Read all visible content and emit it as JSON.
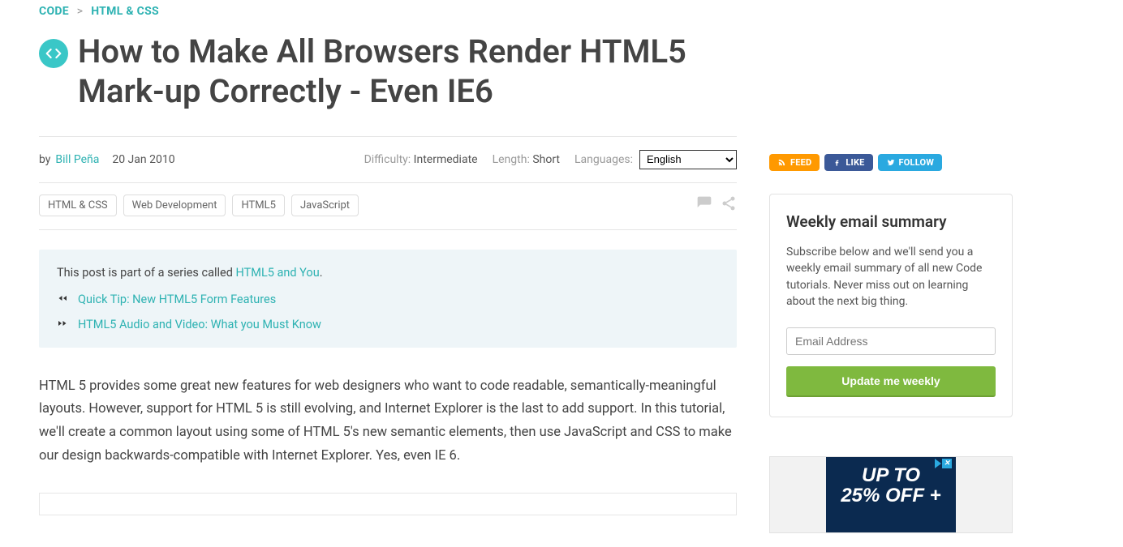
{
  "breadcrumb": {
    "level1": "CODE",
    "level2": "HTML & CSS"
  },
  "title": "How to Make All Browsers Render HTML5 Mark-up Correctly - Even IE6",
  "meta": {
    "by_label": "by",
    "author": "Bill Peña",
    "date": "20 Jan 2010",
    "difficulty_label": "Difficulty:",
    "difficulty_value": "Intermediate",
    "length_label": "Length:",
    "length_value": "Short",
    "languages_label": "Languages:",
    "language_selected": "English"
  },
  "tags": [
    "HTML & CSS",
    "Web Development",
    "HTML5",
    "JavaScript"
  ],
  "series": {
    "intro_prefix": "This post is part of a series called ",
    "name": "HTML5 and You",
    "suffix": ".",
    "prev": "Quick Tip: New HTML5 Form Features",
    "next": "HTML5 Audio and Video: What you Must Know"
  },
  "body_p1": "HTML 5 provides some great new features for web designers who want to code readable, semantically-meaningful layouts. However, support for HTML 5 is still evolving, and Internet Explorer is the last to add support. In this tutorial, we'll create a common layout using some of HTML 5's new semantic elements, then use JavaScript and CSS to make our design backwards-compatible with Internet Explorer. Yes, even IE 6.",
  "social": {
    "feed": "FEED",
    "like": "LIKE",
    "follow": "FOLLOW"
  },
  "email_card": {
    "heading": "Weekly email summary",
    "desc": "Subscribe below and we'll send you a weekly email summary of all new Code tutorials. Never miss out on learning about the next big thing.",
    "placeholder": "Email Address",
    "button": "Update me weekly"
  },
  "ad": {
    "line1": "UP TO",
    "line2": "25% OFF +"
  }
}
